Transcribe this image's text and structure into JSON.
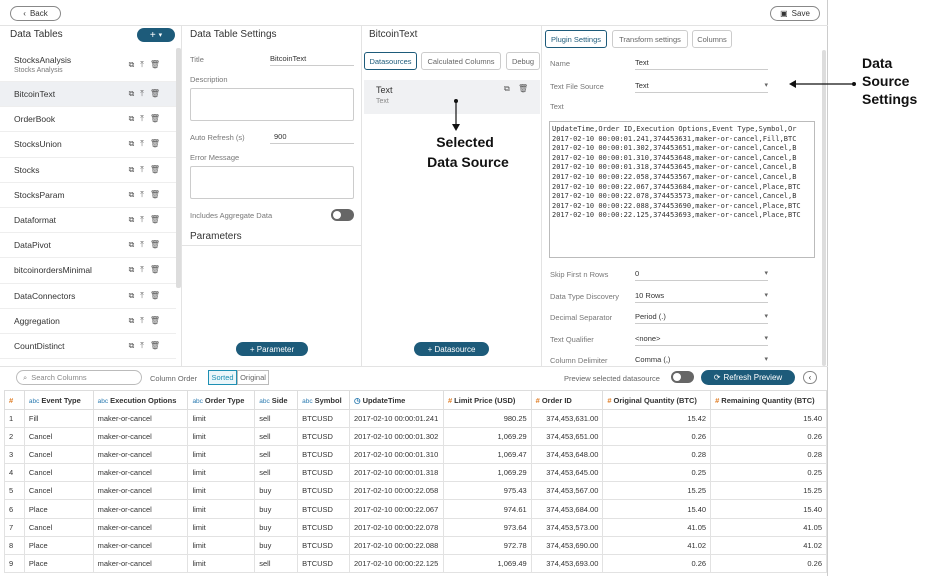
{
  "topbar": {
    "back_label": "Back",
    "save_label": "Save"
  },
  "data_tables": {
    "title": "Data Tables",
    "add_label": "+",
    "items": [
      {
        "name": "StocksAnalysis",
        "sub": "Stocks Analysis"
      },
      {
        "name": "BitcoinText",
        "sub": ""
      },
      {
        "name": "OrderBook",
        "sub": ""
      },
      {
        "name": "StocksUnion",
        "sub": ""
      },
      {
        "name": "Stocks",
        "sub": ""
      },
      {
        "name": "StocksParam",
        "sub": ""
      },
      {
        "name": "Dataformat",
        "sub": ""
      },
      {
        "name": "DataPivot",
        "sub": ""
      },
      {
        "name": "bitcoinordersMinimal",
        "sub": ""
      },
      {
        "name": "DataConnectors",
        "sub": ""
      },
      {
        "name": "Aggregation",
        "sub": ""
      },
      {
        "name": "CountDistinct",
        "sub": ""
      }
    ]
  },
  "settings": {
    "title": "Data Table Settings",
    "title_label": "Title",
    "title_value": "BitcoinText",
    "description_label": "Description",
    "auto_refresh_label": "Auto Refresh (s)",
    "auto_refresh_value": "900",
    "error_message_label": "Error Message",
    "includes_aggregate_label": "Includes Aggregate Data",
    "parameters_label": "Parameters",
    "add_parameter_label": "+ Parameter"
  },
  "middle": {
    "title": "BitcoinText",
    "tabs": [
      "Datasources",
      "Calculated Columns",
      "Debug"
    ],
    "datasource_name": "Text",
    "datasource_type": "Text",
    "add_datasource_label": "+ Datasource"
  },
  "plugin": {
    "tabs": [
      "Plugin Settings",
      "Transform settings",
      "Columns"
    ],
    "name_label": "Name",
    "name_value": "Text",
    "source_label": "Text File Source",
    "source_value": "Text",
    "text_label": "Text",
    "text_lines": [
      "UpdateTime,Order ID,Execution Options,Event Type,Symbol,Or",
      "2017-02-10 00:00:01.241,374453631,maker-or-cancel,Fill,BTC",
      "2017-02-10 00:00:01.302,374453651,maker-or-cancel,Cancel,B",
      "2017-02-10 00:00:01.310,374453648,maker-or-cancel,Cancel,B",
      "2017-02-10 00:00:01.318,374453645,maker-or-cancel,Cancel,B",
      "2017-02-10 00:00:22.058,374453567,maker-or-cancel,Cancel,B",
      "2017-02-10 00:00:22.067,374453684,maker-or-cancel,Place,BTC",
      "2017-02-10 00:00:22.078,374453573,maker-or-cancel,Cancel,B",
      "2017-02-10 00:00:22.088,374453690,maker-or-cancel,Place,BTC",
      "2017-02-10 00:00:22.125,374453693,maker-or-cancel,Place,BTC"
    ],
    "skip_label": "Skip First n Rows",
    "skip_value": "0",
    "discovery_label": "Data Type Discovery",
    "discovery_value": "10 Rows",
    "decimal_label": "Decimal Separator",
    "decimal_value": "Period (.)",
    "qualifier_label": "Text Qualifier",
    "qualifier_value": "<none>",
    "delimiter_label": "Column Delimiter",
    "delimiter_value": "Comma (,)"
  },
  "preview_bar": {
    "search_placeholder": "Search Columns",
    "column_order_label": "Column Order",
    "sorted_label": "Sorted",
    "original_label": "Original",
    "preview_selected_label": "Preview selected datasource",
    "refresh_label": "Refresh Preview"
  },
  "table": {
    "columns": [
      {
        "type": "#",
        "label": ""
      },
      {
        "type": "abc",
        "label": "Event Type"
      },
      {
        "type": "abc",
        "label": "Execution Options"
      },
      {
        "type": "abc",
        "label": "Order Type"
      },
      {
        "type": "abc",
        "label": "Side"
      },
      {
        "type": "abc",
        "label": "Symbol"
      },
      {
        "type": "time",
        "label": "UpdateTime"
      },
      {
        "type": "#",
        "label": "Limit Price (USD)"
      },
      {
        "type": "#",
        "label": "Order ID"
      },
      {
        "type": "#",
        "label": "Original Quantity (BTC)"
      },
      {
        "type": "#",
        "label": "Remaining Quantity (BTC)"
      }
    ],
    "rows": [
      [
        "1",
        "Fill",
        "maker-or-cancel",
        "limit",
        "sell",
        "BTCUSD",
        "2017-02-10 00:00:01.241",
        "980.25",
        "374,453,631.00",
        "15.42",
        "15.40"
      ],
      [
        "2",
        "Cancel",
        "maker-or-cancel",
        "limit",
        "sell",
        "BTCUSD",
        "2017-02-10 00:00:01.302",
        "1,069.29",
        "374,453,651.00",
        "0.26",
        "0.26"
      ],
      [
        "3",
        "Cancel",
        "maker-or-cancel",
        "limit",
        "sell",
        "BTCUSD",
        "2017-02-10 00:00:01.310",
        "1,069.47",
        "374,453,648.00",
        "0.28",
        "0.28"
      ],
      [
        "4",
        "Cancel",
        "maker-or-cancel",
        "limit",
        "sell",
        "BTCUSD",
        "2017-02-10 00:00:01.318",
        "1,069.29",
        "374,453,645.00",
        "0.25",
        "0.25"
      ],
      [
        "5",
        "Cancel",
        "maker-or-cancel",
        "limit",
        "buy",
        "BTCUSD",
        "2017-02-10 00:00:22.058",
        "975.43",
        "374,453,567.00",
        "15.25",
        "15.25"
      ],
      [
        "6",
        "Place",
        "maker-or-cancel",
        "limit",
        "buy",
        "BTCUSD",
        "2017-02-10 00:00:22.067",
        "974.61",
        "374,453,684.00",
        "15.40",
        "15.40"
      ],
      [
        "7",
        "Cancel",
        "maker-or-cancel",
        "limit",
        "buy",
        "BTCUSD",
        "2017-02-10 00:00:22.078",
        "973.64",
        "374,453,573.00",
        "41.05",
        "41.05"
      ],
      [
        "8",
        "Place",
        "maker-or-cancel",
        "limit",
        "buy",
        "BTCUSD",
        "2017-02-10 00:00:22.088",
        "972.78",
        "374,453,690.00",
        "41.02",
        "41.02"
      ],
      [
        "9",
        "Place",
        "maker-or-cancel",
        "limit",
        "sell",
        "BTCUSD",
        "2017-02-10 00:00:22.125",
        "1,069.49",
        "374,453,693.00",
        "0.26",
        "0.26"
      ]
    ]
  },
  "annotations": {
    "selected_line1": "Selected",
    "selected_line2": "Data Source",
    "settings_line1": "Data",
    "settings_line2": "Source",
    "settings_line3": "Settings"
  },
  "colors": {
    "accent": "#1d5b7a",
    "type_text": "#2a7ab0",
    "type_number": "#e0802b"
  }
}
